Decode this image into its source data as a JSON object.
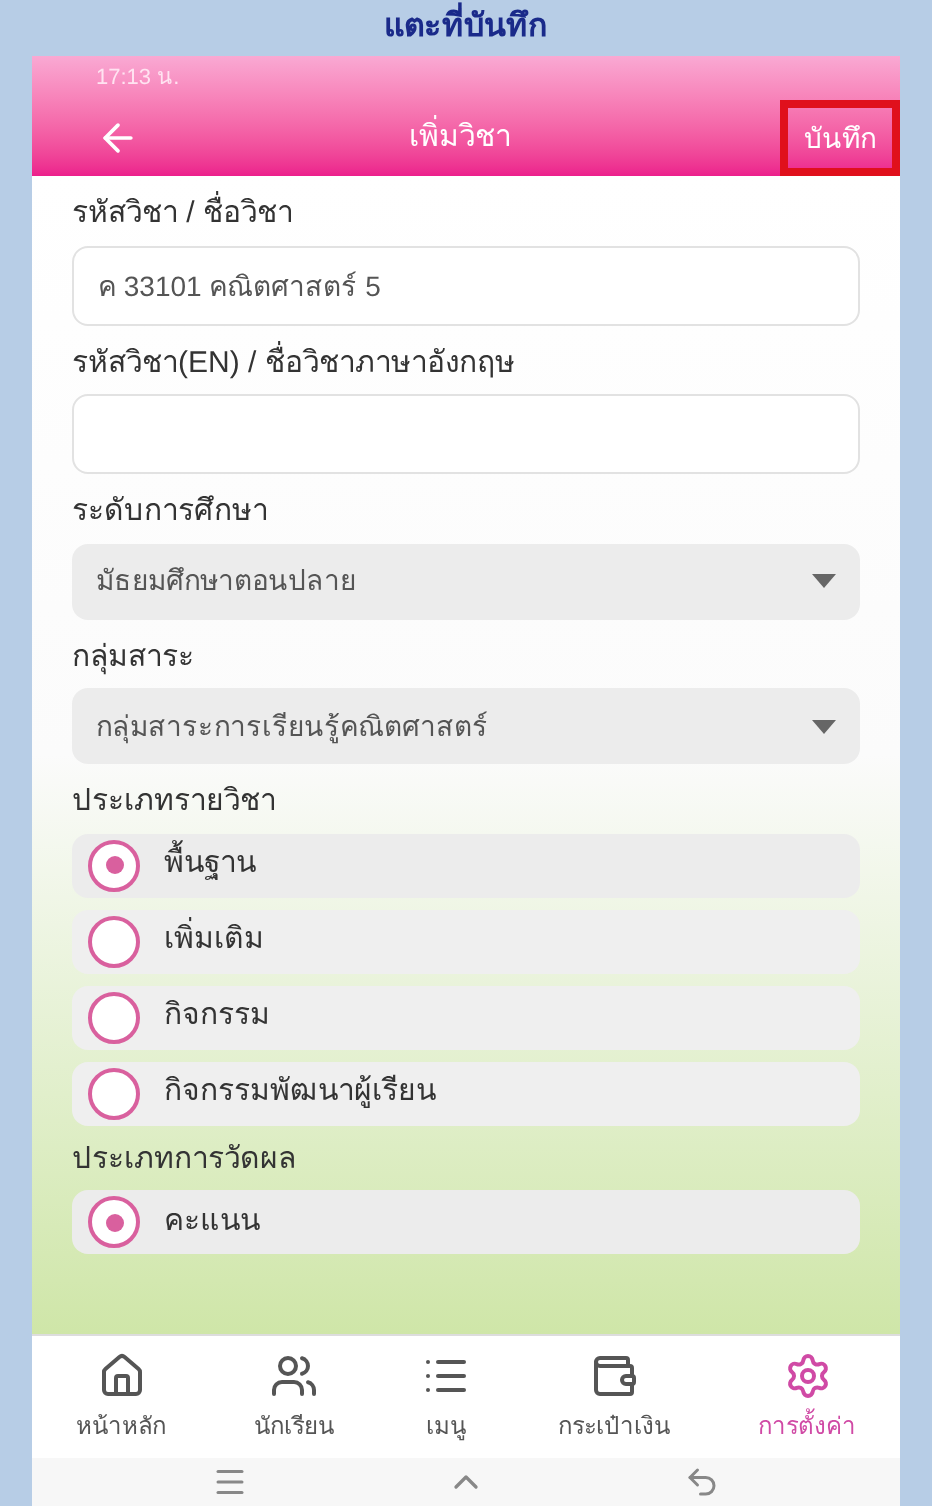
{
  "caption": "แตะที่บันทึก",
  "status_bar": {
    "time": "17:13 น."
  },
  "header": {
    "title": "เพิ่มวิชา",
    "save": "บันทึก",
    "highlighted": true
  },
  "fields": [
    {
      "kind": "text",
      "label": "รหัสวิชา / ชื่อวิชา",
      "value": "ค 33101 คณิตศาสตร์ 5"
    },
    {
      "kind": "text",
      "label": "รหัสวิชา(EN) / ชื่อวิชาภาษาอังกฤษ"
    },
    {
      "kind": "select",
      "label": "ระดับการศึกษา",
      "value": "มัธยมศึกษาตอนปลาย"
    },
    {
      "kind": "select",
      "label": "กลุ่มสาระ",
      "value": "กลุ่มสาระการเรียนรู้คณิตศาสตร์"
    },
    {
      "kind": "radio",
      "label": "ประเภทรายวิชา",
      "options": [
        {
          "label": "พื้นฐาน",
          "selected": true
        },
        {
          "label": "เพิ่มเติม",
          "selected": false
        },
        {
          "label": "กิจกรรม",
          "selected": false
        },
        {
          "label": "กิจกรรมพัฒนาผู้เรียน",
          "selected": false
        }
      ]
    },
    {
      "kind": "radio",
      "label": "ประเภทการวัดผล",
      "options": [
        {
          "label": "คะแนน",
          "selected": true
        }
      ]
    }
  ],
  "bottom_nav": [
    {
      "kind": "home",
      "label": "หน้าหลัก",
      "selected": false
    },
    {
      "kind": "students",
      "label": "นักเรียน",
      "selected": false
    },
    {
      "kind": "menu",
      "label": "เมนู",
      "selected": false
    },
    {
      "kind": "wallet",
      "label": "กระเป๋าเงิน",
      "selected": false
    },
    {
      "kind": "settings",
      "label": "การตั้งค่า",
      "selected": true
    }
  ]
}
